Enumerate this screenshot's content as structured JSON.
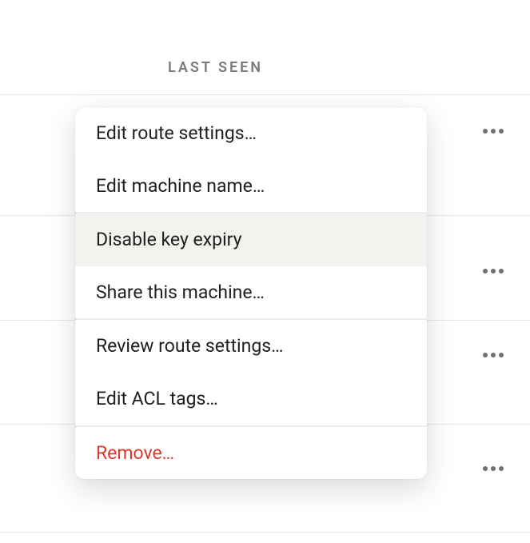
{
  "column_header": "LAST SEEN",
  "menu": {
    "items": [
      {
        "label": "Edit route settings…",
        "danger": false,
        "hovered": false,
        "divider_before": false
      },
      {
        "label": "Edit machine name…",
        "danger": false,
        "hovered": false,
        "divider_before": false
      },
      {
        "label": "Disable key expiry",
        "danger": false,
        "hovered": true,
        "divider_before": true
      },
      {
        "label": "Share this machine…",
        "danger": false,
        "hovered": false,
        "divider_before": false
      },
      {
        "label": "Review route settings…",
        "danger": false,
        "hovered": false,
        "divider_before": true
      },
      {
        "label": "Edit ACL tags…",
        "danger": false,
        "hovered": false,
        "divider_before": false
      },
      {
        "label": "Remove…",
        "danger": true,
        "hovered": false,
        "divider_before": true
      }
    ]
  },
  "rows_count": 4
}
